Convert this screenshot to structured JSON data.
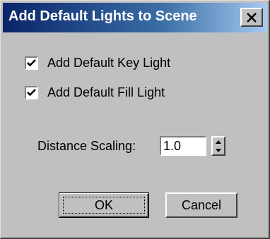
{
  "window": {
    "title": "Add Default Lights to Scene",
    "close_label": "X"
  },
  "options": {
    "key_light": {
      "label": "Add Default Key Light",
      "checked": true
    },
    "fill_light": {
      "label": "Add Default Fill Light",
      "checked": true
    }
  },
  "distance": {
    "label": "Distance Scaling:",
    "value": "1.0"
  },
  "buttons": {
    "ok_label": "OK",
    "cancel_label": "Cancel"
  },
  "colors": {
    "title_gradient_start": "#0a246a",
    "title_gradient_end": "#a6caf0",
    "face": "#c0c0c0"
  }
}
